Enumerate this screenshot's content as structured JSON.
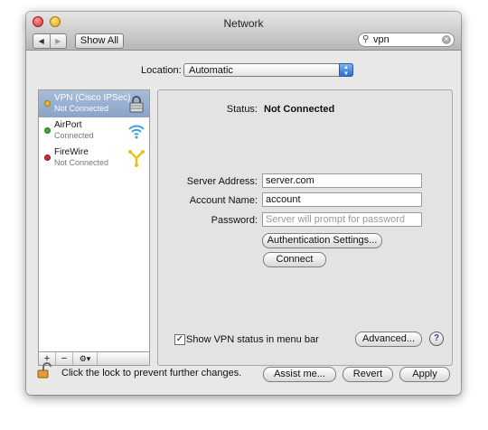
{
  "window": {
    "title": "Network"
  },
  "toolbar": {
    "back": "◀",
    "forward": "▶",
    "show_all": "Show All",
    "search": {
      "value": "vpn",
      "search_icon": "magnifier-icon",
      "clear_icon": "clear-icon"
    }
  },
  "location": {
    "label": "Location:",
    "value": "Automatic"
  },
  "services": [
    {
      "name": "VPN (Cisco IPSec)",
      "status": "Not Connected",
      "dot_color": "#e8b82a",
      "icon": "lock-icon",
      "selected": true
    },
    {
      "name": "AirPort",
      "status": "Connected",
      "dot_color": "#35b035",
      "icon": "wifi-icon",
      "selected": false
    },
    {
      "name": "FireWire",
      "status": "Not Connected",
      "dot_color": "#d42a2a",
      "icon": "firewire-icon",
      "selected": false
    }
  ],
  "service_bar": {
    "add": "+",
    "remove": "−",
    "gear": "⚙▾"
  },
  "detail": {
    "status_label": "Status:",
    "status_value": "Not Connected",
    "server_address_label": "Server Address:",
    "server_address_value": "server.com",
    "account_name_label": "Account Name:",
    "account_name_value": "account",
    "password_label": "Password:",
    "password_placeholder": "Server will prompt for password",
    "auth_button": "Authentication Settings...",
    "connect_button": "Connect",
    "show_status_label": "Show VPN status in menu bar",
    "show_status_checked": true,
    "advanced_button": "Advanced...",
    "help_button": "?"
  },
  "footer": {
    "lock_text": "Click the lock to prevent further changes.",
    "assist_button": "Assist me...",
    "revert_button": "Revert",
    "apply_button": "Apply"
  }
}
